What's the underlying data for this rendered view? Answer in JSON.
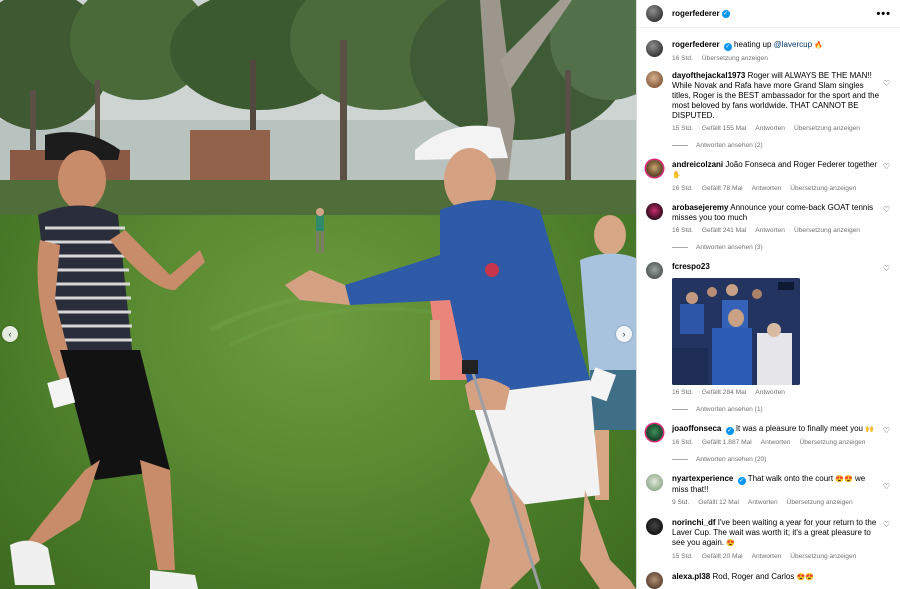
{
  "post": {
    "author": "rogerfederer",
    "more_icon": "more-horizontal-icon",
    "prev_icon": "chevron-left-icon",
    "next_icon": "chevron-right-icon",
    "prev_label": "‹",
    "next_label": "›"
  },
  "caption": {
    "user": "rogerfederer",
    "text": "heating up",
    "mention": "@lavercup",
    "emoji": "🔥",
    "time": "16 Std.",
    "translate": "Übersetzung anzeigen"
  },
  "comments": [
    {
      "user": "dayofthejackal1973",
      "text": "Roger will ALWAYS BE THE MAN!! While Novak and Rafa have more Grand Slam singles titles, Roger is the BEST ambassador for the sport and the most beloved by fans worldwide. THAT CANNOT BE DISPUTED.",
      "time": "15 Std.",
      "likes": "Gefällt 155 Mal",
      "reply": "Antworten",
      "translate": "Übersetzung anzeigen",
      "replies": "Antworten ansehen (2)"
    },
    {
      "user": "andreicolzani",
      "text": "João Fonseca and Roger Federer together",
      "emoji": "✋",
      "time": "16 Std.",
      "likes": "Gefällt 78 Mal",
      "reply": "Antworten",
      "translate": "Übersetzung anzeigen"
    },
    {
      "user": "arobasejeremy",
      "text": "Announce your come-back GOAT tennis misses you too much",
      "time": "16 Std.",
      "likes": "Gefällt 241 Mal",
      "reply": "Antworten",
      "translate": "Übersetzung anzeigen",
      "replies": "Antworten ansehen (3)"
    },
    {
      "user": "fcrespo23",
      "time": "16 Std.",
      "likes": "Gefällt 284 Mal",
      "reply": "Antworten",
      "replies": "Antworten ansehen (1)"
    },
    {
      "user": "joaoffonseca",
      "text": "It was a pleasure to finally meet you",
      "emoji": "🙌",
      "time": "16 Std.",
      "likes": "Gefällt 1.887 Mal",
      "reply": "Antworten",
      "translate": "Übersetzung anzeigen",
      "replies": "Antworten ansehen (20)"
    },
    {
      "user": "nyartexperience",
      "text": "That walk onto the court",
      "emoji": "😍😍",
      "text2": "we miss that!!",
      "time": "9 Std.",
      "likes": "Gefällt 12 Mal",
      "reply": "Antworten",
      "translate": "Übersetzung anzeigen"
    },
    {
      "user": "norinchi_df",
      "text": "I've been waiting a year for your return to the Laver Cup. The wait was worth it; it's a great pleasure to see you again.",
      "emoji": "😍",
      "time": "15 Std.",
      "likes": "Gefällt 20 Mal",
      "reply": "Antworten",
      "translate": "Übersetzung anzeigen"
    },
    {
      "user": "alexa.pl38",
      "text": "Rod, Roger and Carlos",
      "emoji": "😍😍"
    }
  ],
  "colors": {
    "accent": "#0095f6",
    "mention": "#00376b",
    "muted": "#737373",
    "grass": "#5a8a31"
  },
  "icons": {
    "heart": "heart-outline-icon",
    "verified": "verified-badge-icon"
  },
  "glyphs": {
    "heart": "♡",
    "verified": "✓",
    "more": "•••"
  }
}
